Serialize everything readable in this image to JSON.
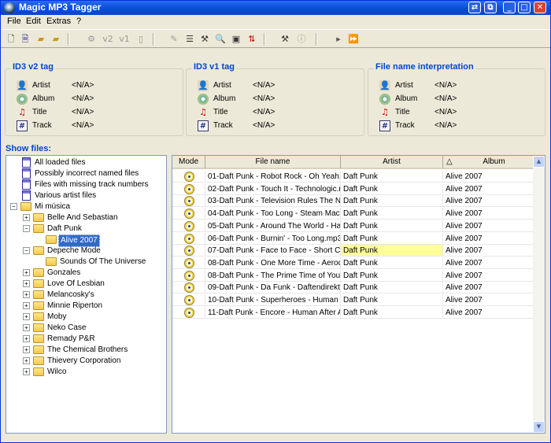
{
  "window": {
    "title": "Magic MP3 Tagger"
  },
  "menu": [
    "File",
    "Edit",
    "Extras",
    "?"
  ],
  "toolbar": {
    "v2_label": "v2",
    "v1_label": "v1"
  },
  "panels": [
    {
      "title": "ID3 v2 tag",
      "fields": [
        {
          "icon": "artist-icon",
          "label": "Artist",
          "value": "<N/A>"
        },
        {
          "icon": "album-icon",
          "label": "Album",
          "value": "<N/A>"
        },
        {
          "icon": "title-icon",
          "label": "Title",
          "value": "<N/A>"
        },
        {
          "icon": "track-icon",
          "label": "Track",
          "value": "<N/A>"
        }
      ]
    },
    {
      "title": "ID3 v1 tag",
      "fields": [
        {
          "icon": "artist-icon",
          "label": "Artist",
          "value": "<N/A>"
        },
        {
          "icon": "album-icon",
          "label": "Album",
          "value": "<N/A>"
        },
        {
          "icon": "title-icon",
          "label": "Title",
          "value": "<N/A>"
        },
        {
          "icon": "track-icon",
          "label": "Track",
          "value": "<N/A>"
        }
      ]
    },
    {
      "title": "File name interpretation",
      "fields": [
        {
          "icon": "artist-icon",
          "label": "Artist",
          "value": "<N/A>"
        },
        {
          "icon": "album-icon",
          "label": "Album",
          "value": "<N/A>"
        },
        {
          "icon": "title-icon",
          "label": "Title",
          "value": "<N/A>"
        },
        {
          "icon": "track-icon",
          "label": "Track",
          "value": "<N/A>"
        }
      ]
    }
  ],
  "show_files_label": "Show files:",
  "filters": [
    "All loaded files",
    "Possibly incorrect named files",
    "Files with missing track numbers",
    "Various artist files"
  ],
  "tree_root": "Mi música",
  "tree_folders": [
    {
      "name": "Belle And Sebastian",
      "expanded": false
    },
    {
      "name": "Daft Punk",
      "expanded": true,
      "children": [
        {
          "name": "Alive 2007",
          "selected": true
        }
      ]
    },
    {
      "name": "Depeche Mode",
      "expanded": true,
      "children": [
        {
          "name": "Sounds Of The Universe",
          "selected": false
        }
      ]
    },
    {
      "name": "Gonzales",
      "expanded": false
    },
    {
      "name": "Love Of Lesbian",
      "expanded": false
    },
    {
      "name": "Melancosky's",
      "expanded": false
    },
    {
      "name": "Minnie Riperton",
      "expanded": false
    },
    {
      "name": "Moby",
      "expanded": false
    },
    {
      "name": "Neko Case",
      "expanded": false
    },
    {
      "name": "Remady P&R",
      "expanded": false
    },
    {
      "name": "The Chemical Brothers",
      "expanded": false
    },
    {
      "name": "Thievery Corporation",
      "expanded": false
    },
    {
      "name": "Wilco",
      "expanded": false
    }
  ],
  "table": {
    "columns": [
      "Mode",
      "File name",
      "Artist",
      "Album"
    ],
    "sort_indicator": "△",
    "rows": [
      {
        "file": "01-Daft Punk - Robot Rock - Oh Yeah.r",
        "artist": "Daft Punk",
        "album": "Alive 2007"
      },
      {
        "file": "02-Daft Punk - Touch It - Technologic.n",
        "artist": "Daft Punk",
        "album": "Alive 2007"
      },
      {
        "file": "03-Daft Punk - Television Rules The Na",
        "artist": "Daft Punk",
        "album": "Alive 2007"
      },
      {
        "file": "04-Daft Punk - Too Long - Steam Mach",
        "artist": "Daft Punk",
        "album": "Alive 2007"
      },
      {
        "file": "05-Daft Punk - Around The World - Harc",
        "artist": "Daft Punk",
        "album": "Alive 2007"
      },
      {
        "file": "06-Daft Punk - Burnin' - Too Long.mp3",
        "artist": "Daft Punk",
        "album": "Alive 2007"
      },
      {
        "file": "07-Daft Punk - Face to Face - Short Circ",
        "artist": "Daft Punk",
        "album": "Alive 2007"
      },
      {
        "file": "08-Daft Punk - One More Time - Aerody",
        "artist": "Daft Punk",
        "album": "Alive 2007"
      },
      {
        "file": "08-Daft Punk - The Prime Time of Your l",
        "artist": "Daft Punk",
        "album": "Alive 2007"
      },
      {
        "file": "09-Daft Punk - Da Funk - Daftendirekt.n",
        "artist": "Daft Punk",
        "album": "Alive 2007"
      },
      {
        "file": "10-Daft Punk - Superheroes - Human Af",
        "artist": "Daft Punk",
        "album": "Alive 2007"
      },
      {
        "file": "11-Daft Punk - Encore - Human After All",
        "artist": "Daft Punk",
        "album": "Alive 2007"
      }
    ],
    "highlight_row": 6,
    "highlight_color": "#FFFF99"
  },
  "colors": {
    "accent": "#0046D5",
    "selection": "#316AC5",
    "titlebar": "#0A4EDC"
  }
}
